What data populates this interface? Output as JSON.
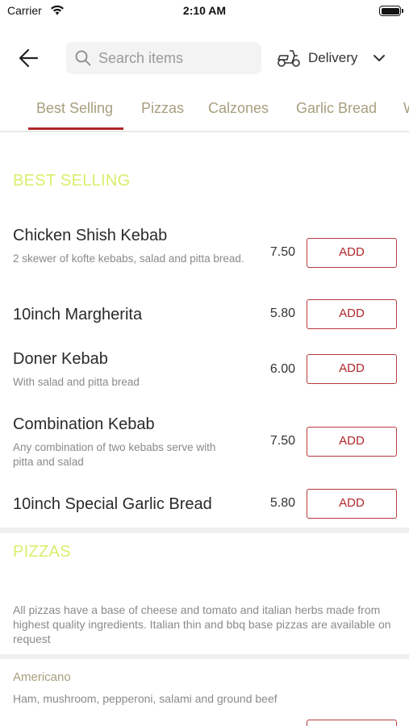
{
  "status_bar": {
    "carrier": "Carrier",
    "time": "2:10 AM"
  },
  "header": {
    "search": {
      "placeholder": "Search items",
      "value": ""
    },
    "delivery": {
      "label": "Delivery"
    }
  },
  "tabs": [
    "Best Selling",
    "Pizzas",
    "Calzones",
    "Garlic Bread",
    "W"
  ],
  "active_tab": "Best Selling",
  "sections": {
    "best_selling": {
      "title": "BEST SELLING",
      "items": [
        {
          "name": "Chicken Shish Kebab",
          "description": "2 skewer of kofte kebabs, salad and pitta bread.",
          "price": "7.50",
          "button": "ADD"
        },
        {
          "name": "10inch Margherita",
          "description": "",
          "price": "5.80",
          "button": "ADD"
        },
        {
          "name": "Doner Kebab",
          "description": "With salad and pitta bread",
          "price": "6.00",
          "button": "ADD"
        },
        {
          "name": "Combination Kebab",
          "description": "Any combination of two kebabs serve with pitta and salad",
          "price": "7.50",
          "button": "ADD"
        },
        {
          "name": "10inch Special Garlic Bread",
          "description": "",
          "price": "5.80",
          "button": "ADD"
        }
      ]
    },
    "pizzas": {
      "title": "PIZZAS",
      "note": "All pizzas have a base of cheese and tomato and italian herbs made from highest quality ingredients. Italian thin and bbq base pizzas are available on request",
      "items": [
        {
          "name": "Americano",
          "description": "Ham, mushroom, pepperoni, salami and ground beef"
        }
      ]
    }
  },
  "colors": {
    "accent_red": "#b0262a",
    "section_title": "#d8ef6b",
    "tab_text": "#a89e7e",
    "muted_text": "#8a8a8a"
  }
}
